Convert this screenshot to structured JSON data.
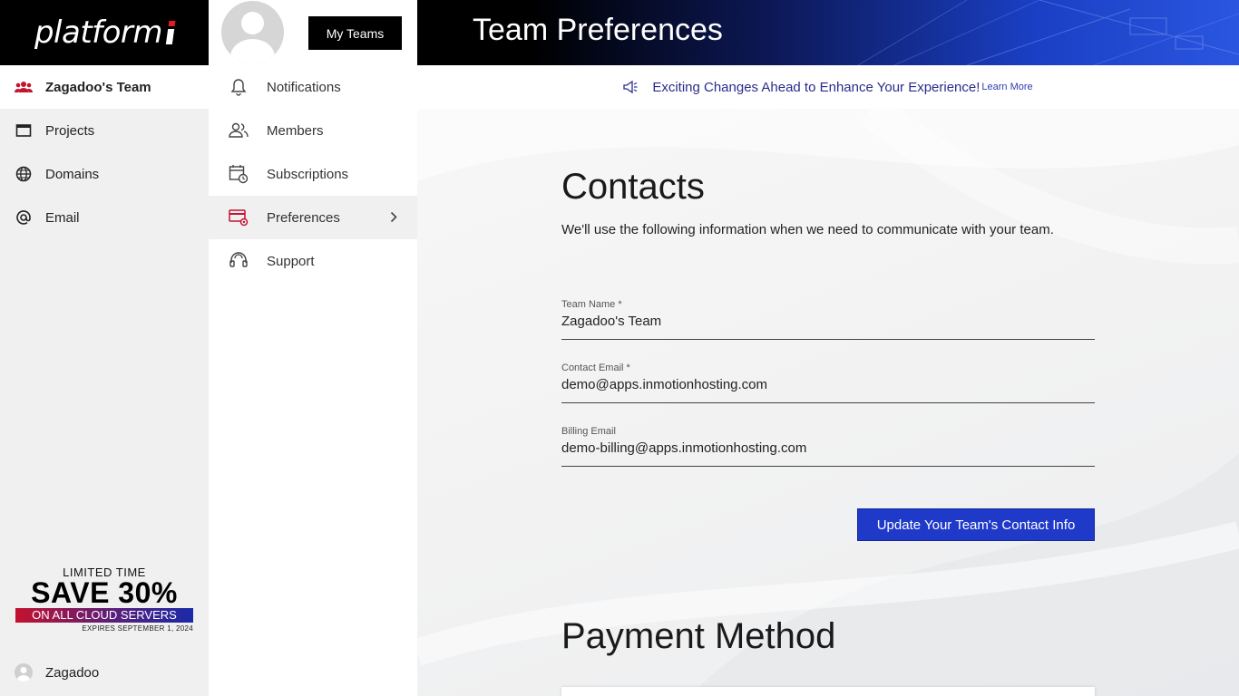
{
  "app": {
    "logo": "platform",
    "page_title": "Team Preferences"
  },
  "sidebar": {
    "team": "Zagadoo's Team",
    "items": [
      {
        "label": "Projects",
        "icon": "window-icon"
      },
      {
        "label": "Domains",
        "icon": "globe-icon"
      },
      {
        "label": "Email",
        "icon": "at-icon"
      }
    ],
    "promo": {
      "line1": "LIMITED TIME",
      "line2": "SAVE 30%",
      "line3": "ON ALL CLOUD SERVERS",
      "line4": "EXPIRES SEPTEMBER 1, 2024"
    },
    "user": "Zagadoo"
  },
  "team_menu": {
    "my_teams_label": "My Teams",
    "items": [
      {
        "label": "Notifications",
        "icon": "bell-icon"
      },
      {
        "label": "Members",
        "icon": "members-icon"
      },
      {
        "label": "Subscriptions",
        "icon": "calendar-refresh-icon"
      },
      {
        "label": "Preferences",
        "icon": "card-settings-icon",
        "active": true
      },
      {
        "label": "Support",
        "icon": "headset-icon"
      }
    ]
  },
  "announcement": {
    "text": "Exciting Changes Ahead to Enhance Your Experience!",
    "link": "Learn More"
  },
  "contacts": {
    "heading": "Contacts",
    "description": "We'll use the following information when we need to communicate with your team.",
    "fields": [
      {
        "label": "Team Name *",
        "value": "Zagadoo's Team"
      },
      {
        "label": "Contact Email *",
        "value": "demo@apps.inmotionhosting.com"
      },
      {
        "label": "Billing Email",
        "value": "demo-billing@apps.inmotionhosting.com"
      }
    ],
    "submit_label": "Update Your Team's Contact Info"
  },
  "payment": {
    "heading": "Payment Method"
  },
  "colors": {
    "accent": "#1f39c8",
    "brand_red": "#c4122f",
    "header_bg": "#000000"
  }
}
